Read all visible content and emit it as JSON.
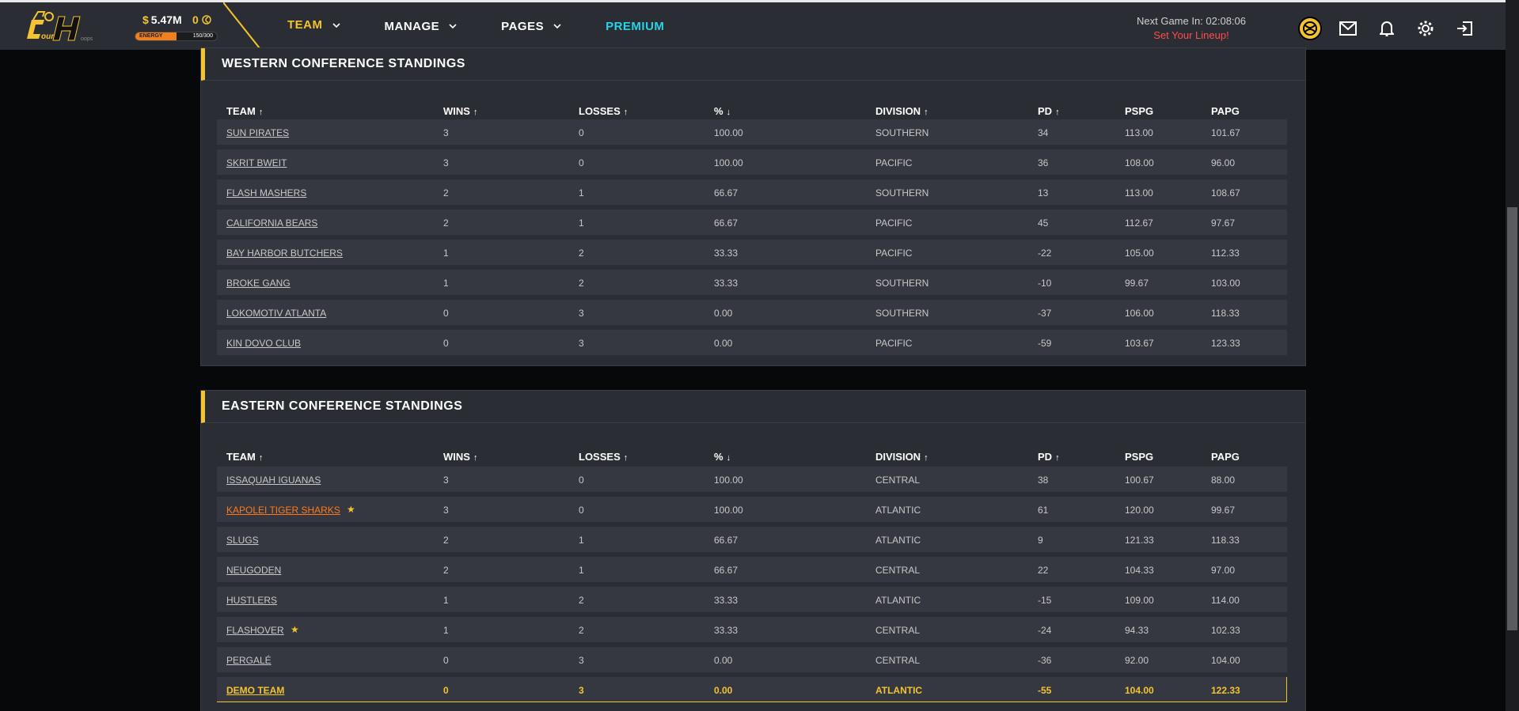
{
  "header": {
    "money": "5.47M",
    "coins": "0",
    "energy_label": "ENERGY",
    "energy_value": "150/300",
    "energy_fraction": 0.5,
    "nav": [
      {
        "label": "TEAM"
      },
      {
        "label": "MANAGE"
      },
      {
        "label": "PAGES"
      },
      {
        "label": "PREMIUM"
      }
    ],
    "next_game": "Next Game In: 02:08:06",
    "lineup_link": "Set Your Lineup!"
  },
  "columns": [
    "TEAM",
    "WINS",
    "LOSSES",
    "%",
    "DIVISION",
    "PD",
    "PSPG",
    "PAPG"
  ],
  "sort_arrows": [
    "↑",
    "↑",
    "↑",
    "↓",
    "↑",
    "↑",
    "",
    ""
  ],
  "western": {
    "title": "WESTERN CONFERENCE STANDINGS",
    "rows": [
      [
        "SUN PIRATES",
        "3",
        "0",
        "100.00",
        "SOUTHERN",
        "34",
        "113.00",
        "101.67"
      ],
      [
        "SKRIT BWEIT",
        "3",
        "0",
        "100.00",
        "PACIFIC",
        "36",
        "108.00",
        "96.00"
      ],
      [
        "FLASH MASHERS",
        "2",
        "1",
        "66.67",
        "SOUTHERN",
        "13",
        "113.00",
        "108.67"
      ],
      [
        "CALIFORNIA BEARS",
        "2",
        "1",
        "66.67",
        "PACIFIC",
        "45",
        "112.67",
        "97.67"
      ],
      [
        "BAY HARBOR BUTCHERS",
        "1",
        "2",
        "33.33",
        "PACIFIC",
        "-22",
        "105.00",
        "112.33"
      ],
      [
        "BROKE GANG",
        "1",
        "2",
        "33.33",
        "SOUTHERN",
        "-10",
        "99.67",
        "103.00"
      ],
      [
        "LOKOMOTIV ATLANTA",
        "0",
        "3",
        "0.00",
        "SOUTHERN",
        "-37",
        "106.00",
        "118.33"
      ],
      [
        "KIN DOVO CLUB",
        "0",
        "3",
        "0.00",
        "PACIFIC",
        "-59",
        "103.67",
        "123.33"
      ]
    ]
  },
  "eastern": {
    "title": "EASTERN CONFERENCE STANDINGS",
    "rows": [
      [
        "ISSAQUAH IGUANAS",
        "3",
        "0",
        "100.00",
        "CENTRAL",
        "38",
        "100.67",
        "88.00"
      ],
      [
        "KAPOLEI TIGER SHARKS",
        "3",
        "0",
        "100.00",
        "ATLANTIC",
        "61",
        "120.00",
        "99.67"
      ],
      [
        "SLUGS",
        "2",
        "1",
        "66.67",
        "ATLANTIC",
        "9",
        "121.33",
        "118.33"
      ],
      [
        "NEUGODEN",
        "2",
        "1",
        "66.67",
        "CENTRAL",
        "22",
        "104.33",
        "97.00"
      ],
      [
        "HUSTLERS",
        "1",
        "2",
        "33.33",
        "ATLANTIC",
        "-15",
        "109.00",
        "114.00"
      ],
      [
        "FLASHOVER",
        "1",
        "2",
        "33.33",
        "CENTRAL",
        "-24",
        "94.33",
        "102.33"
      ],
      [
        "PERGALÉ",
        "0",
        "3",
        "0.00",
        "CENTRAL",
        "-36",
        "92.00",
        "104.00"
      ],
      [
        "DEMO TEAM",
        "0",
        "3",
        "0.00",
        "ATLANTIC",
        "-55",
        "104.00",
        "122.33"
      ]
    ],
    "starred": [
      1,
      5
    ],
    "orange_row": 1,
    "own_row": 7
  },
  "colors": {
    "accent": "#f4c430",
    "premium": "#28d3e6",
    "alert": "#ff4d4d",
    "rival": "#ff7a1a"
  }
}
